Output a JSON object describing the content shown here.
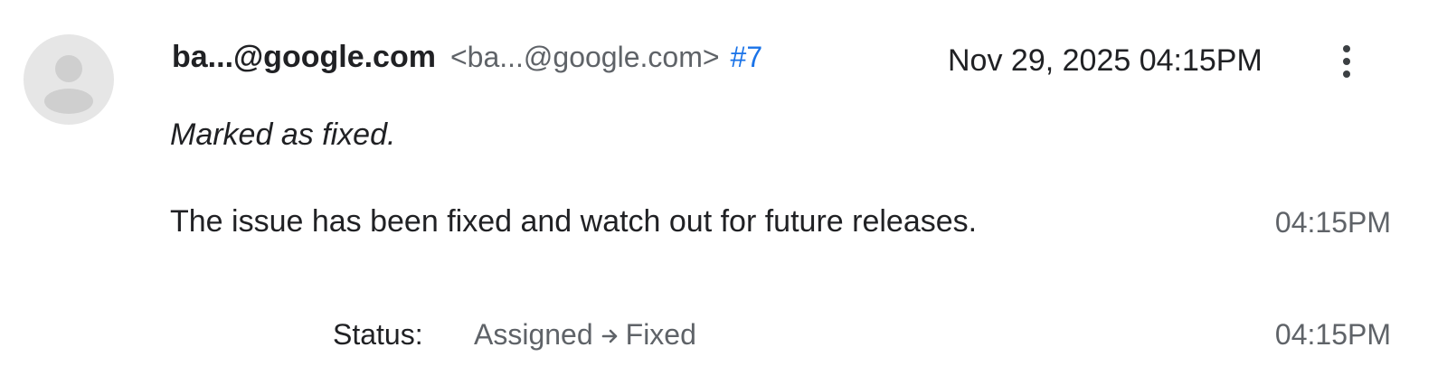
{
  "comment": {
    "sender_name": "ba...@google.com",
    "sender_email": "<ba...@google.com>",
    "comment_number": "#7",
    "date": "Nov 29, 2025 04:15PM",
    "marked_text": "Marked as fixed.",
    "body_text": "The issue has been fixed and watch out for future releases.",
    "body_time": "04:15PM",
    "status": {
      "label": "Status:",
      "from": "Assigned",
      "to": "Fixed",
      "time": "04:15PM"
    }
  },
  "icons": {
    "avatar": "person-icon",
    "more": "more-vert-icon",
    "arrow": "arrow-right-icon"
  },
  "colors": {
    "link": "#1a73e8",
    "secondary_text": "#5f6368",
    "primary_text": "#202124",
    "avatar_bg": "#e6e6e6",
    "avatar_fg": "#cfcfcf"
  }
}
